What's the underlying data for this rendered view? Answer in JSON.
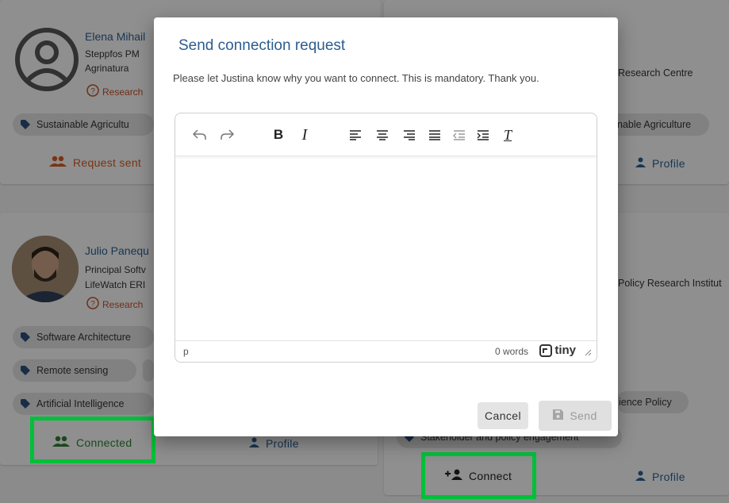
{
  "cards": {
    "elena": {
      "name": "Elena Mihail",
      "title": "Steppfos PM",
      "org": "Agrinatura",
      "role": "Research",
      "tag": "Sustainable Agricultu",
      "action": "Request sent"
    },
    "right_top": {
      "org": "Research Centre",
      "tag": "nable Agriculture",
      "profile": "Profile"
    },
    "julio": {
      "name": "Julio Panequ",
      "title": "Principal Softv",
      "org": "LifeWatch ERI",
      "role": "Research",
      "tags": [
        "Software Architecture",
        "Remote sensing",
        "Artificial Intelligence"
      ],
      "action": "Connected",
      "profile": "Profile"
    },
    "right_bottom": {
      "org": "Policy Research Institut",
      "tag": "ience Policy",
      "tag2": "Stakeholder and policy engagement",
      "action": "Connect",
      "profile": "Profile"
    }
  },
  "modal": {
    "title": "Send connection request",
    "message": "Please let Justina know why you want to connect. This is mandatory. Thank you.",
    "editor": {
      "path": "p",
      "word_count": "0 words",
      "brand": "tiny"
    },
    "cancel_label": "Cancel",
    "send_label": "Send"
  },
  "colors": {
    "highlight": "#00c03a",
    "link": "#2c5d8f",
    "accent": "#d05a22"
  }
}
